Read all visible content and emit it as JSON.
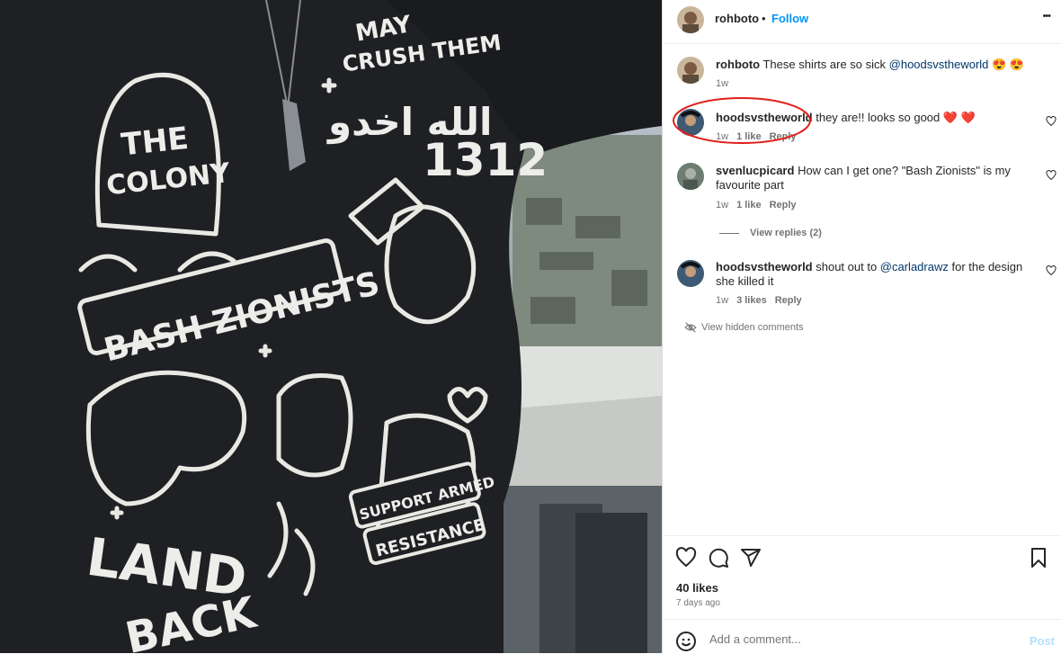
{
  "post": {
    "username": "rohboto",
    "follow_label": "Follow",
    "dot": "•",
    "more": "•••",
    "shirt_text": {
      "top_line1": "MAY",
      "top_line2": "CRUSH THEM",
      "arabic": "الله اخدو",
      "colony1": "THE",
      "colony2": "COLONY",
      "number": "1312",
      "bash": "BASH ZIONISTS",
      "support1": "SUPPORT ARMED",
      "support2": "RESISTANCE",
      "land": "LAND",
      "back": "BACK"
    }
  },
  "caption": {
    "username": "rohboto",
    "text": "These shirts are so sick ",
    "mention": "@hoodsvstheworld",
    "emoji": "😍 😍",
    "time": "1w"
  },
  "comments": [
    {
      "username": "hoodsvstheworld",
      "text": " they are!! looks so good ",
      "emoji": "❤️ ❤️",
      "time": "1w",
      "likes": "1 like",
      "reply": "Reply"
    },
    {
      "username": "svenlucpicard",
      "text": "How can I get one? \"Bash Zionists\" is my favourite part",
      "time": "1w",
      "likes": "1 like",
      "reply": "Reply",
      "view_replies": "View replies (2)"
    },
    {
      "username": "hoodsvstheworld",
      "text_before": " shout out to ",
      "mention": "@carladrawz",
      "text_after": " for the design she killed it",
      "time": "1w",
      "likes": "3 likes",
      "reply": "Reply"
    }
  ],
  "hidden_label": "View hidden comments",
  "footer": {
    "likes": "40 likes",
    "ago": "7 days ago",
    "add_comment_placeholder": "Add a comment...",
    "post_label": "Post"
  },
  "colors": {
    "accent": "#0095f6",
    "link": "#00376b",
    "annotation": "#e0201c",
    "heart": "#ed4956"
  }
}
